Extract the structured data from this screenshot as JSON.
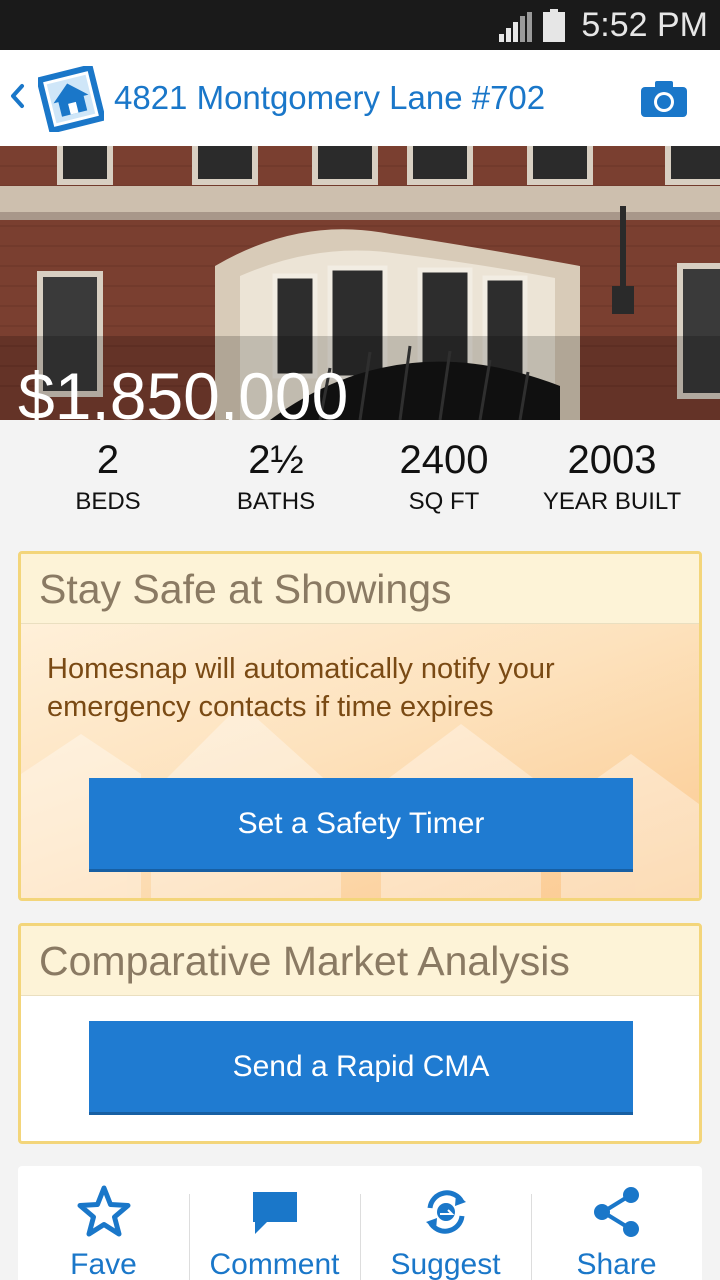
{
  "status_bar": {
    "time": "5:52 PM"
  },
  "header": {
    "title": "4821 Montgomery Lane #702"
  },
  "hero": {
    "price": "$1,850,000"
  },
  "stats": [
    {
      "value": "2",
      "label": "BEDS"
    },
    {
      "value": "2½",
      "label": "BATHS"
    },
    {
      "value": "2400",
      "label": "SQ FT"
    },
    {
      "value": "2003",
      "label": "YEAR BUILT"
    }
  ],
  "safety_card": {
    "title": "Stay Safe at Showings",
    "message": "Homesnap will automatically notify your emergency contacts if time expires",
    "button": "Set a Safety Timer"
  },
  "cma_card": {
    "title": "Comparative Market Analysis",
    "button": "Send a Rapid CMA"
  },
  "actions": [
    {
      "label": "Fave",
      "icon": "star-icon"
    },
    {
      "label": "Comment",
      "icon": "comment-icon"
    },
    {
      "label": "Suggest",
      "icon": "suggest-icon"
    },
    {
      "label": "Share",
      "icon": "share-icon"
    }
  ],
  "colors": {
    "accent": "#1a77c9",
    "button": "#1f7bd1",
    "card_border": "#f3d57a"
  }
}
